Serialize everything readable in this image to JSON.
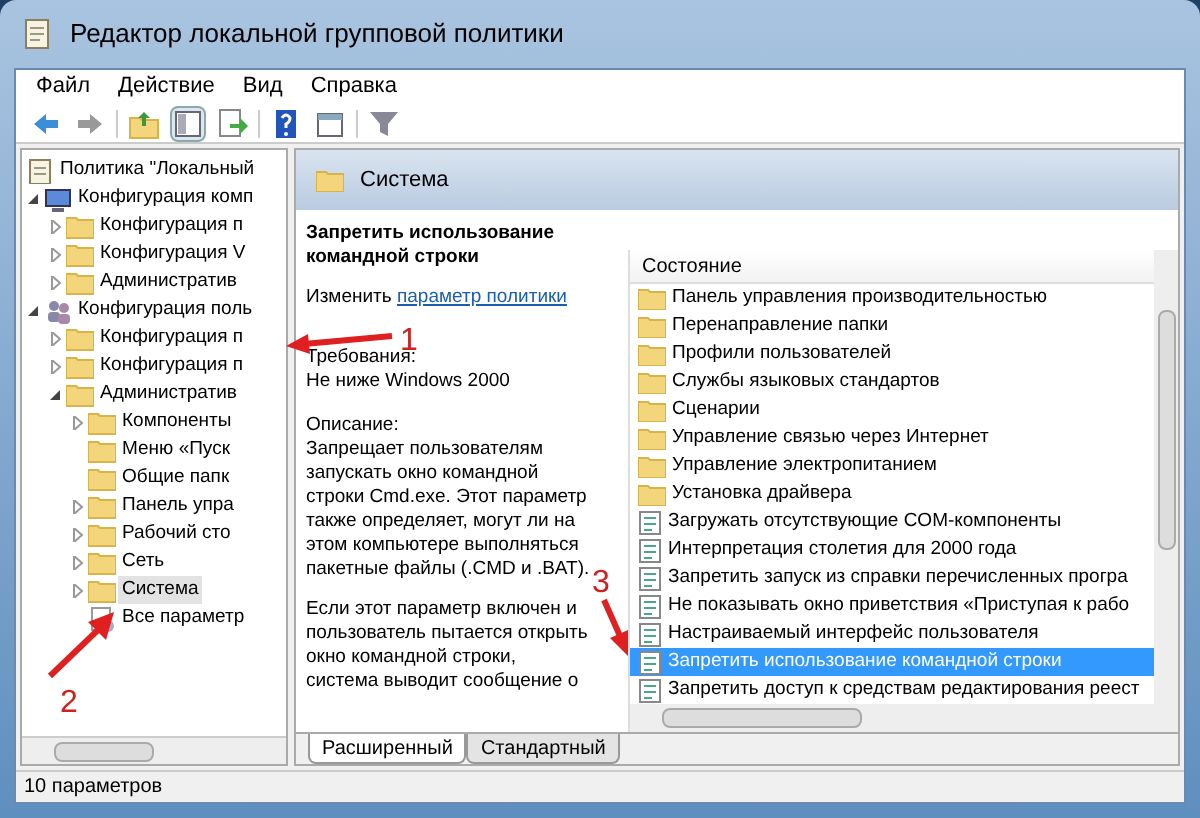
{
  "window": {
    "title": "Редактор локальной групповой политики"
  },
  "menu": [
    "Файл",
    "Действие",
    "Вид",
    "Справка"
  ],
  "toolbar": [
    {
      "kind": "back"
    },
    {
      "kind": "forward"
    },
    {
      "kind": "up"
    },
    {
      "kind": "tree",
      "selected": true
    },
    {
      "kind": "export"
    },
    {
      "kind": "help"
    },
    {
      "kind": "props"
    },
    {
      "kind": "filter"
    }
  ],
  "tree": [
    {
      "label": "Политика \"Локальный",
      "kind": "root",
      "children": [
        {
          "label": "Конфигурация комп",
          "kind": "computer",
          "expanded": true,
          "children": [
            {
              "label": "Конфигурация п",
              "kind": "folder",
              "expanded": false
            },
            {
              "label": "Конфигурация V",
              "kind": "folder",
              "expanded": false
            },
            {
              "label": "Административ",
              "kind": "folder",
              "expanded": false
            }
          ]
        },
        {
          "label": "Конфигурация поль",
          "kind": "users",
          "expanded": true,
          "children": [
            {
              "label": "Конфигурация п",
              "kind": "folder",
              "expanded": false
            },
            {
              "label": "Конфигурация п",
              "kind": "folder",
              "expanded": false
            },
            {
              "label": "Административ",
              "kind": "folder",
              "expanded": true,
              "children": [
                {
                  "label": "Компоненты",
                  "kind": "folder",
                  "expanded": false
                },
                {
                  "label": "Меню «Пуск",
                  "kind": "leaf"
                },
                {
                  "label": "Общие папк",
                  "kind": "leaf"
                },
                {
                  "label": "Панель упра",
                  "kind": "folder",
                  "expanded": false
                },
                {
                  "label": "Рабочий сто",
                  "kind": "folder",
                  "expanded": false
                },
                {
                  "label": "Сеть",
                  "kind": "folder",
                  "expanded": false
                },
                {
                  "label": "Система",
                  "kind": "folder",
                  "expanded": false,
                  "selected": true
                },
                {
                  "label": "Все параметр",
                  "kind": "all"
                }
              ]
            }
          ]
        }
      ]
    }
  ],
  "panel": {
    "title": "Система",
    "description": {
      "title": "Запретить использование командной строки",
      "edit_prefix": "Изменить",
      "edit_link": "параметр политики",
      "requirements_label": "Требования:",
      "requirements": "Не ниже Windows 2000",
      "description_label": "Описание:",
      "paragraphs": [
        "Запрещает пользователям запускать окно командной строки Cmd.exe. Этот параметр также определяет, могут ли на этом компьютере выполняться пакетные файлы (.CMD и .BAT).",
        "Если этот параметр включен и пользователь пытается открыть окно командной строки, система выводит сообщение о"
      ]
    },
    "column": "Состояние",
    "items": [
      {
        "label": "Панель управления производительностью",
        "kind": "folder",
        "selected": false
      },
      {
        "label": "Перенаправление папки",
        "kind": "folder",
        "selected": false
      },
      {
        "label": "Профили пользователей",
        "kind": "folder",
        "selected": false
      },
      {
        "label": "Службы языковых стандартов",
        "kind": "folder",
        "selected": false
      },
      {
        "label": "Сценарии",
        "kind": "folder",
        "selected": false
      },
      {
        "label": "Управление связью через Интернет",
        "kind": "folder",
        "selected": false
      },
      {
        "label": "Управление электропитанием",
        "kind": "folder",
        "selected": false
      },
      {
        "label": "Установка драйвера",
        "kind": "folder",
        "selected": false
      },
      {
        "label": "Загружать отсутствующие COM-компоненты",
        "kind": "setting",
        "selected": false
      },
      {
        "label": "Интерпретация столетия для 2000 года",
        "kind": "setting",
        "selected": false
      },
      {
        "label": "Запретить запуск из справки перечисленных програ",
        "kind": "setting",
        "selected": false
      },
      {
        "label": "Не показывать окно приветствия «Приступая к рабо",
        "kind": "setting",
        "selected": false
      },
      {
        "label": "Настраиваемый интерфейс пользователя",
        "kind": "setting",
        "selected": false
      },
      {
        "label": "Запретить использование командной строки",
        "kind": "setting",
        "selected": true
      },
      {
        "label": "Запретить доступ к средствам редактирования реест",
        "kind": "setting",
        "selected": false
      }
    ],
    "tabs": [
      {
        "label": "Расширенный",
        "selected": true
      },
      {
        "label": "Стандартный",
        "selected": false
      }
    ]
  },
  "status_bar": "10 параметров",
  "annotations": [
    {
      "number": "1"
    },
    {
      "number": "2"
    },
    {
      "number": "3"
    }
  ]
}
